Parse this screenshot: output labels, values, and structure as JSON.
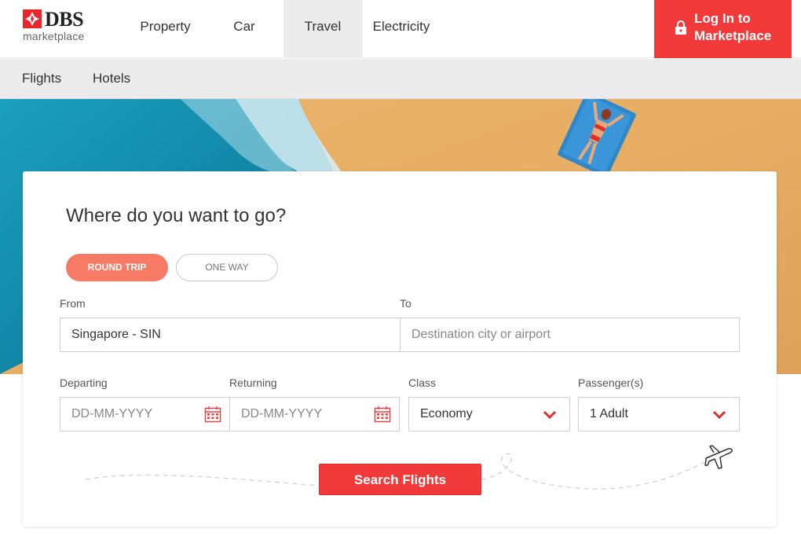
{
  "brand": {
    "name": "DBS",
    "sub": "marketplace",
    "color": "#f23a3a"
  },
  "nav": {
    "items": [
      {
        "label": "Property",
        "active": false
      },
      {
        "label": "Car",
        "active": false
      },
      {
        "label": "Travel",
        "active": true
      },
      {
        "label": "Electricity",
        "active": false
      }
    ],
    "login_label": "Log In to Marketplace"
  },
  "subnav": {
    "items": [
      "Flights",
      "Hotels"
    ]
  },
  "search": {
    "heading": "Where do you want to go?",
    "trip_types": [
      "ROUND TRIP",
      "ONE WAY"
    ],
    "selected_trip_type": "ROUND TRIP",
    "from_label": "From",
    "from_value": "Singapore - SIN",
    "to_label": "To",
    "to_placeholder": "Destination city or airport",
    "departing_label": "Departing",
    "departing_placeholder": "DD-MM-YYYY",
    "returning_label": "Returning",
    "returning_placeholder": "DD-MM-YYYY",
    "class_label": "Class",
    "class_value": "Economy",
    "passengers_label": "Passenger(s)",
    "passengers_value": "1 Adult",
    "submit_label": "Search Flights"
  },
  "icons": {
    "logo": "dbs-star-icon",
    "lock": "lock-icon",
    "calendar": "calendar-icon",
    "chevron": "chevron-down-icon",
    "plane": "airplane-icon"
  },
  "colors": {
    "accent": "#f23a3a",
    "pill_active": "#f67a65",
    "nav_active_bg": "#ebebeb"
  }
}
